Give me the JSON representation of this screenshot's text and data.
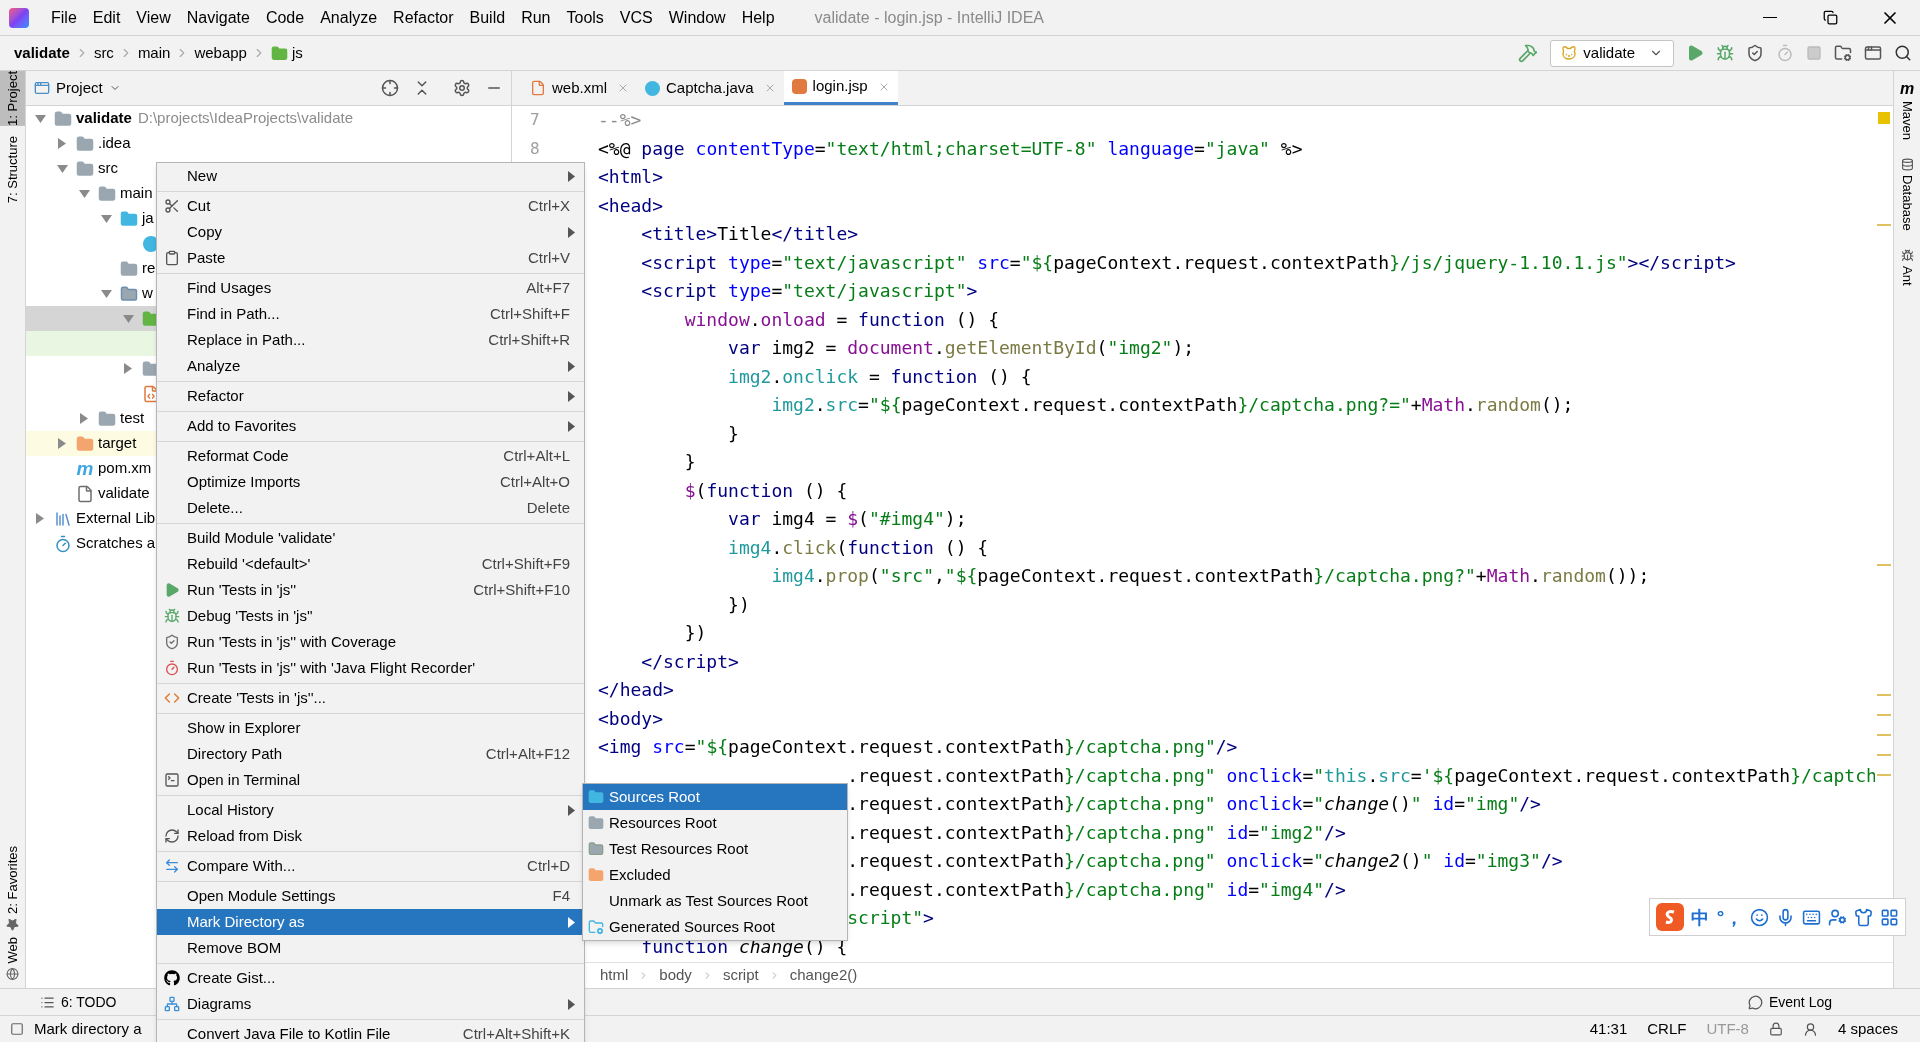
{
  "title_bar": {
    "menus": [
      "File",
      "Edit",
      "View",
      "Navigate",
      "Code",
      "Analyze",
      "Refactor",
      "Build",
      "Run",
      "Tools",
      "VCS",
      "Window",
      "Help"
    ],
    "title": "validate - login.jsp - IntelliJ IDEA"
  },
  "nav_bar": {
    "crumbs": [
      {
        "label": "validate",
        "kind": "module"
      },
      {
        "label": "src",
        "kind": "plain"
      },
      {
        "label": "main",
        "kind": "plain"
      },
      {
        "label": "webapp",
        "kind": "plain"
      },
      {
        "label": "js",
        "kind": "folder"
      }
    ],
    "run_config": "validate"
  },
  "left_strip_top": [
    {
      "label": "1: Project",
      "selected": true
    },
    {
      "label": "7: Structure",
      "selected": false
    }
  ],
  "left_strip_bottom": [
    {
      "label": "2: Favorites",
      "kind": "star"
    },
    {
      "label": "Web",
      "kind": "globe"
    }
  ],
  "project_panel": {
    "title": "Project",
    "tree": [
      {
        "label": "validate",
        "detail": "D:\\projects\\IdeaProjects\\validate",
        "kind": "module",
        "expanded": true,
        "selected": false,
        "children": [
          {
            "label": ".idea",
            "kind": "folder",
            "expanded": false,
            "selected": false
          },
          {
            "label": "src",
            "kind": "folder",
            "expanded": true,
            "selected": false,
            "children": [
              {
                "label": "main",
                "kind": "folder",
                "expanded": true,
                "selected": false,
                "children": [
                  {
                    "label": "ja",
                    "kind": "source-folder",
                    "expanded": true,
                    "selected": false,
                    "children": [
                      {
                        "kind": "class",
                        "selected": false
                      }
                    ]
                  },
                  {
                    "label": "re",
                    "kind": "resources-folder",
                    "selected": false
                  },
                  {
                    "label": "w",
                    "kind": "web-folder",
                    "expanded": true,
                    "selected": false,
                    "children": [
                      {
                        "kind": "green-folder",
                        "expanded": true,
                        "selected": true,
                        "children": [
                          {
                            "selected": false,
                            "color": "#e9f6e2"
                          }
                        ]
                      },
                      {
                        "kind": "folder",
                        "expanded": false,
                        "selected": false
                      },
                      {
                        "kind": "js-file",
                        "selected": false
                      }
                    ]
                  }
                ]
              },
              {
                "label": "test",
                "kind": "folder",
                "expanded": false,
                "selected": false
              }
            ]
          },
          {
            "label": "target",
            "kind": "orange-folder",
            "expanded": false,
            "selected": false,
            "color": "#fdfbe2"
          },
          {
            "label": "pom.xm",
            "kind": "maven",
            "glyph": "m",
            "selected": false
          },
          {
            "label": "validate",
            "kind": "iml",
            "selected": false
          }
        ]
      },
      {
        "label": "External Lib",
        "kind": "library",
        "expanded": false,
        "selected": false
      },
      {
        "label": "Scratches a",
        "kind": "scratches",
        "selected": false
      }
    ]
  },
  "editor": {
    "tabs": [
      {
        "label": "web.xml",
        "kind": "xml",
        "selected": false
      },
      {
        "label": "Captcha.java",
        "kind": "class",
        "selected": false
      },
      {
        "label": "login.jsp",
        "kind": "jsp",
        "selected": true
      }
    ],
    "lines": [
      {
        "number": "7",
        "kind": "full",
        "tokens": [
          {
            "kind": "comment",
            "text": "--%>"
          }
        ]
      },
      {
        "number": "8",
        "kind": "full",
        "tokens": [
          {
            "kind": "plain",
            "text": "<%@ "
          },
          {
            "kind": "tag",
            "text": "page "
          },
          {
            "kind": "attr",
            "text": "contentType"
          },
          {
            "kind": "plain",
            "text": "="
          },
          {
            "kind": "str",
            "text": "\"text/html;charset=UTF-8\" "
          },
          {
            "kind": "attr",
            "text": "language"
          },
          {
            "kind": "plain",
            "text": "="
          },
          {
            "kind": "str",
            "text": "\"java\""
          },
          {
            "kind": "plain",
            "text": " %>"
          }
        ]
      },
      {
        "kind": "full",
        "tokens": [
          {
            "kind": "tag",
            "text": "<html>"
          }
        ]
      },
      {
        "kind": "full",
        "tokens": [
          {
            "kind": "tag",
            "text": "<head>"
          }
        ]
      },
      {
        "kind": "full",
        "tokens": [
          {
            "kind": "tag",
            "text": "    <title>"
          },
          {
            "kind": "plain",
            "text": "Title"
          },
          {
            "kind": "tag",
            "text": "</title>"
          }
        ]
      },
      {
        "kind": "full",
        "tokens": [
          {
            "kind": "tag",
            "text": "    <script "
          },
          {
            "kind": "attr",
            "text": "type"
          },
          {
            "kind": "plain",
            "text": "="
          },
          {
            "kind": "str",
            "text": "\"text/javascript\" "
          },
          {
            "kind": "attr",
            "text": "src"
          },
          {
            "kind": "plain",
            "text": "="
          },
          {
            "kind": "str",
            "text": "\"${"
          },
          {
            "kind": "plain",
            "text": "pageContext.request.contextPath"
          },
          {
            "kind": "str",
            "text": "}/js/jquery-1.10.1.js\""
          },
          {
            "kind": "tag",
            "text": "></script>"
          }
        ]
      },
      {
        "kind": "full",
        "tokens": [
          {
            "kind": "tag",
            "text": "    <script "
          },
          {
            "kind": "attr",
            "text": "type"
          },
          {
            "kind": "plain",
            "text": "="
          },
          {
            "kind": "str",
            "text": "\"text/javascript\""
          },
          {
            "kind": "tag",
            "text": ">"
          }
        ]
      },
      {
        "kind": "full",
        "tokens": [
          {
            "kind": "global",
            "text": "        window"
          },
          {
            "kind": "plain",
            "text": "."
          },
          {
            "kind": "global",
            "text": "onload"
          },
          {
            "kind": "plain",
            "text": " = "
          },
          {
            "kind": "kw",
            "text": "function"
          },
          {
            "kind": "plain",
            "text": " () {"
          }
        ]
      },
      {
        "kind": "full",
        "tokens": [
          {
            "kind": "kw",
            "text": "            var"
          },
          {
            "kind": "plain",
            "text": " img2 = "
          },
          {
            "kind": "global",
            "text": "document"
          },
          {
            "kind": "plain",
            "text": "."
          },
          {
            "kind": "method",
            "text": "getElementById"
          },
          {
            "kind": "plain",
            "text": "("
          },
          {
            "kind": "str",
            "text": "\"img2\""
          },
          {
            "kind": "plain",
            "text": ");"
          }
        ]
      },
      {
        "kind": "full",
        "tokens": [
          {
            "kind": "local",
            "text": "            img2"
          },
          {
            "kind": "plain",
            "text": "."
          },
          {
            "kind": "local",
            "text": "onclick"
          },
          {
            "kind": "plain",
            "text": " = "
          },
          {
            "kind": "kw",
            "text": "function"
          },
          {
            "kind": "plain",
            "text": " () {"
          }
        ]
      },
      {
        "kind": "full",
        "tokens": [
          {
            "kind": "local",
            "text": "                img2"
          },
          {
            "kind": "plain",
            "text": "."
          },
          {
            "kind": "local",
            "text": "src"
          },
          {
            "kind": "plain",
            "text": "="
          },
          {
            "kind": "str",
            "text": "\"${"
          },
          {
            "kind": "plain",
            "text": "pageContext.request.contextPath"
          },
          {
            "kind": "str",
            "text": "}/captcha.png?=\""
          },
          {
            "kind": "plain",
            "text": "+"
          },
          {
            "kind": "global",
            "text": "Math"
          },
          {
            "kind": "plain",
            "text": "."
          },
          {
            "kind": "method",
            "text": "random"
          },
          {
            "kind": "plain",
            "text": "();"
          }
        ]
      },
      {
        "kind": "full",
        "tokens": [
          {
            "kind": "plain",
            "text": "            }"
          }
        ]
      },
      {
        "kind": "full",
        "tokens": [
          {
            "kind": "plain",
            "text": "        }"
          }
        ]
      },
      {
        "kind": "full",
        "tokens": [
          {
            "kind": "global",
            "text": "        $"
          },
          {
            "kind": "plain",
            "text": "("
          },
          {
            "kind": "kw",
            "text": "function"
          },
          {
            "kind": "plain",
            "text": " () {"
          }
        ]
      },
      {
        "kind": "full",
        "tokens": [
          {
            "kind": "kw",
            "text": "            var"
          },
          {
            "kind": "plain",
            "text": " img4 = "
          },
          {
            "kind": "global",
            "text": "$"
          },
          {
            "kind": "plain",
            "text": "("
          },
          {
            "kind": "str",
            "text": "\"#img4\""
          },
          {
            "kind": "plain",
            "text": ");"
          }
        ]
      },
      {
        "kind": "full",
        "tokens": [
          {
            "kind": "local",
            "text": "            img4"
          },
          {
            "kind": "plain",
            "text": "."
          },
          {
            "kind": "method",
            "text": "click"
          },
          {
            "kind": "plain",
            "text": "("
          },
          {
            "kind": "kw",
            "text": "function"
          },
          {
            "kind": "plain",
            "text": " () {"
          }
        ]
      },
      {
        "kind": "full",
        "tokens": [
          {
            "kind": "local",
            "text": "                img4"
          },
          {
            "kind": "plain",
            "text": "."
          },
          {
            "kind": "method",
            "text": "prop"
          },
          {
            "kind": "plain",
            "text": "("
          },
          {
            "kind": "str",
            "text": "\"src\""
          },
          {
            "kind": "plain",
            "text": ","
          },
          {
            "kind": "str",
            "text": "\"${"
          },
          {
            "kind": "plain",
            "text": "pageContext.request.contextPath"
          },
          {
            "kind": "str",
            "text": "}/captcha.png?\""
          },
          {
            "kind": "plain",
            "text": "+"
          },
          {
            "kind": "global",
            "text": "Math"
          },
          {
            "kind": "plain",
            "text": "."
          },
          {
            "kind": "method",
            "text": "random"
          },
          {
            "kind": "plain",
            "text": "());"
          }
        ]
      },
      {
        "kind": "full",
        "tokens": [
          {
            "kind": "plain",
            "text": "            })"
          }
        ]
      },
      {
        "kind": "full",
        "tokens": [
          {
            "kind": "plain",
            "text": "        })"
          }
        ]
      },
      {
        "kind": "full",
        "tokens": [
          {
            "kind": "tag",
            "text": "    </script>"
          }
        ]
      },
      {
        "kind": "full",
        "tokens": [
          {
            "kind": "tag",
            "text": "</head>"
          }
        ]
      },
      {
        "kind": "full",
        "tokens": [
          {
            "kind": "tag",
            "text": "<body>"
          }
        ]
      },
      {
        "kind": "full",
        "tokens": [
          {
            "kind": "tag",
            "text": "<img "
          },
          {
            "kind": "attr",
            "text": "src"
          },
          {
            "kind": "plain",
            "text": "="
          },
          {
            "kind": "str",
            "text": "\"${"
          },
          {
            "kind": "plain",
            "text": "pageContext.request.contextPath"
          },
          {
            "kind": "str",
            "text": "}/captcha.png\""
          },
          {
            "kind": "tag",
            "text": "/>"
          }
        ]
      },
      {
        "kind": "partial",
        "tokens": [
          {
            "kind": "plain",
            "text": ".request.contextPath"
          },
          {
            "kind": "str",
            "text": "}/captcha.png\" "
          },
          {
            "kind": "attr",
            "text": "onclick"
          },
          {
            "kind": "plain",
            "text": "="
          },
          {
            "kind": "str",
            "text": "\""
          },
          {
            "kind": "local",
            "text": "this"
          },
          {
            "kind": "plain",
            "text": "."
          },
          {
            "kind": "local",
            "text": "src"
          },
          {
            "kind": "plain",
            "text": "="
          },
          {
            "kind": "str",
            "text": "'${"
          },
          {
            "kind": "plain",
            "text": "pageContext.request.contextPath"
          },
          {
            "kind": "str",
            "text": "}/captch"
          }
        ]
      },
      {
        "kind": "partial",
        "tokens": [
          {
            "kind": "plain",
            "text": ".request.contextPath"
          },
          {
            "kind": "str",
            "text": "}/captcha.png\" "
          },
          {
            "kind": "attr",
            "text": "onclick"
          },
          {
            "kind": "plain",
            "text": "="
          },
          {
            "kind": "str",
            "text": "\""
          },
          {
            "kind": "italic",
            "text": "change"
          },
          {
            "kind": "plain",
            "text": "()"
          },
          {
            "kind": "str",
            "text": "\" "
          },
          {
            "kind": "attr",
            "text": "id"
          },
          {
            "kind": "plain",
            "text": "="
          },
          {
            "kind": "str",
            "text": "\"img\""
          },
          {
            "kind": "tag",
            "text": "/>"
          }
        ]
      },
      {
        "kind": "partial",
        "tokens": [
          {
            "kind": "plain",
            "text": ".request.contextPath"
          },
          {
            "kind": "str",
            "text": "}/captcha.png\" "
          },
          {
            "kind": "attr",
            "text": "id"
          },
          {
            "kind": "plain",
            "text": "="
          },
          {
            "kind": "str",
            "text": "\"img2\""
          },
          {
            "kind": "tag",
            "text": "/>"
          }
        ]
      },
      {
        "kind": "partial",
        "tokens": [
          {
            "kind": "plain",
            "text": ".request.contextPath"
          },
          {
            "kind": "str",
            "text": "}/captcha.png\" "
          },
          {
            "kind": "attr",
            "text": "onclick"
          },
          {
            "kind": "plain",
            "text": "="
          },
          {
            "kind": "str",
            "text": "\""
          },
          {
            "kind": "italic",
            "text": "change2"
          },
          {
            "kind": "plain",
            "text": "()"
          },
          {
            "kind": "str",
            "text": "\" "
          },
          {
            "kind": "attr",
            "text": "id"
          },
          {
            "kind": "plain",
            "text": "="
          },
          {
            "kind": "str",
            "text": "\"img3\""
          },
          {
            "kind": "tag",
            "text": "/>"
          }
        ]
      },
      {
        "kind": "partial",
        "tokens": [
          {
            "kind": "plain",
            "text": ".request.contextPath"
          },
          {
            "kind": "str",
            "text": "}/captcha.png\" "
          },
          {
            "kind": "attr",
            "text": "id"
          },
          {
            "kind": "plain",
            "text": "="
          },
          {
            "kind": "str",
            "text": "\"img4\""
          },
          {
            "kind": "tag",
            "text": "/>"
          }
        ]
      },
      {
        "kind": "partial",
        "tokens": [
          {
            "kind": "str",
            "text": "script\""
          },
          {
            "kind": "tag",
            "text": ">"
          }
        ]
      },
      {
        "kind": "full",
        "tokens": [
          {
            "kind": "kw",
            "text": "    function "
          },
          {
            "kind": "italic",
            "text": "change"
          },
          {
            "kind": "plain",
            "text": "() {"
          }
        ]
      }
    ],
    "breadcrumbs": [
      "html",
      "body",
      "script",
      "change2()"
    ]
  },
  "right_strip": [
    {
      "label": "Maven",
      "glyph": "m",
      "kind": "maven"
    },
    {
      "label": "Database",
      "kind": "database"
    },
    {
      "label": "Ant",
      "kind": "ant"
    }
  ],
  "context_menu": [
    {
      "kind": "plain",
      "label": "New",
      "submenu": true,
      "selected": false
    },
    {
      "kind": "separator"
    },
    {
      "kind": "scissors",
      "label": "Cut",
      "shortcut": "Ctrl+X",
      "submenu": false,
      "selected": false
    },
    {
      "kind": "plain",
      "label": "Copy",
      "submenu": true,
      "selected": false
    },
    {
      "kind": "clipboard",
      "label": "Paste",
      "shortcut": "Ctrl+V",
      "submenu": false,
      "selected": false
    },
    {
      "kind": "separator"
    },
    {
      "kind": "plain",
      "label": "Find Usages",
      "shortcut": "Alt+F7",
      "submenu": false,
      "selected": false
    },
    {
      "kind": "plain",
      "label": "Find in Path...",
      "shortcut": "Ctrl+Shift+F",
      "submenu": false,
      "selected": false
    },
    {
      "kind": "plain",
      "label": "Replace in Path...",
      "shortcut": "Ctrl+Shift+R",
      "submenu": false,
      "selected": false
    },
    {
      "kind": "plain",
      "label": "Analyze",
      "submenu": true,
      "selected": false
    },
    {
      "kind": "separator"
    },
    {
      "kind": "plain",
      "label": "Refactor",
      "submenu": true,
      "selected": false
    },
    {
      "kind": "separator"
    },
    {
      "kind": "plain",
      "label": "Add to Favorites",
      "submenu": true,
      "selected": false
    },
    {
      "kind": "separator"
    },
    {
      "kind": "plain",
      "label": "Reformat Code",
      "shortcut": "Ctrl+Alt+L",
      "submenu": false,
      "selected": false
    },
    {
      "kind": "plain",
      "label": "Optimize Imports",
      "shortcut": "Ctrl+Alt+O",
      "submenu": false,
      "selected": false
    },
    {
      "kind": "plain",
      "label": "Delete...",
      "shortcut": "Delete",
      "submenu": false,
      "selected": false
    },
    {
      "kind": "separator"
    },
    {
      "kind": "plain",
      "label": "Build Module 'validate'",
      "submenu": false,
      "selected": false
    },
    {
      "kind": "plain",
      "label": "Rebuild '<default>'",
      "shortcut": "Ctrl+Shift+F9",
      "submenu": false,
      "selected": false
    },
    {
      "kind": "run",
      "label": "Run 'Tests in 'js''",
      "shortcut": "Ctrl+Shift+F10",
      "submenu": false,
      "selected": false
    },
    {
      "kind": "debug",
      "label": "Debug 'Tests in 'js''",
      "submenu": false,
      "selected": false
    },
    {
      "kind": "coverage",
      "label": "Run 'Tests in 'js'' with Coverage",
      "submenu": false,
      "selected": false
    },
    {
      "kind": "recorder",
      "label": "Run 'Tests in 'js'' with 'Java Flight Recorder'",
      "submenu": false,
      "selected": false
    },
    {
      "kind": "separator"
    },
    {
      "kind": "create",
      "label": "Create 'Tests in 'js''...",
      "submenu": false,
      "selected": false
    },
    {
      "kind": "separator"
    },
    {
      "kind": "plain",
      "label": "Show in Explorer",
      "submenu": false,
      "selected": false
    },
    {
      "kind": "plain",
      "label": "Directory Path",
      "shortcut": "Ctrl+Alt+F12",
      "submenu": false,
      "selected": false
    },
    {
      "kind": "terminal",
      "label": "Open in Terminal",
      "submenu": false,
      "selected": false
    },
    {
      "kind": "separator"
    },
    {
      "kind": "plain",
      "label": "Local History",
      "submenu": true,
      "selected": false
    },
    {
      "kind": "reload",
      "label": "Reload from Disk",
      "submenu": false,
      "selected": false
    },
    {
      "kind": "separator"
    },
    {
      "kind": "compare",
      "label": "Compare With...",
      "shortcut": "Ctrl+D",
      "submenu": false,
      "selected": false
    },
    {
      "kind": "separator"
    },
    {
      "kind": "plain",
      "label": "Open Module Settings",
      "shortcut": "F4",
      "submenu": false,
      "selected": false
    },
    {
      "kind": "plain",
      "label": "Mark Directory as",
      "submenu": true,
      "selected": true
    },
    {
      "kind": "plain",
      "label": "Remove BOM",
      "submenu": false,
      "selected": false
    },
    {
      "kind": "separator"
    },
    {
      "kind": "github",
      "label": "Create Gist...",
      "submenu": false,
      "selected": false
    },
    {
      "kind": "diagram",
      "label": "Diagrams",
      "submenu": true,
      "selected": false
    },
    {
      "kind": "separator"
    },
    {
      "kind": "plain",
      "label": "Convert Java File to Kotlin File",
      "shortcut": "Ctrl+Alt+Shift+K",
      "submenu": false,
      "selected": false
    }
  ],
  "submenu": [
    {
      "label": "Sources Root",
      "kind": "sources",
      "selected": true
    },
    {
      "label": "Resources Root",
      "kind": "resources",
      "selected": false
    },
    {
      "label": "Test Resources Root",
      "kind": "test-resources",
      "selected": false
    },
    {
      "label": "Excluded",
      "kind": "excluded",
      "selected": false
    },
    {
      "label": "Unmark as Test Sources Root",
      "kind": "plain",
      "selected": false
    },
    {
      "label": "Generated Sources Root",
      "kind": "generated",
      "selected": false
    }
  ],
  "ime_toolbar": {
    "items": [
      "中",
      "°，"
    ]
  },
  "tool_bar": {
    "left": "6: TODO",
    "right": "Event Log"
  },
  "status_bar": {
    "message": "Mark directory a",
    "items": [
      {
        "kind": "text",
        "label": "41:31",
        "disabled": false
      },
      {
        "kind": "text",
        "label": "CRLF",
        "disabled": false
      },
      {
        "kind": "text",
        "label": "UTF-8",
        "disabled": true
      },
      {
        "kind": "lock"
      },
      {
        "kind": "inspector"
      },
      {
        "kind": "text",
        "label": "4 spaces",
        "disabled": false
      }
    ]
  }
}
